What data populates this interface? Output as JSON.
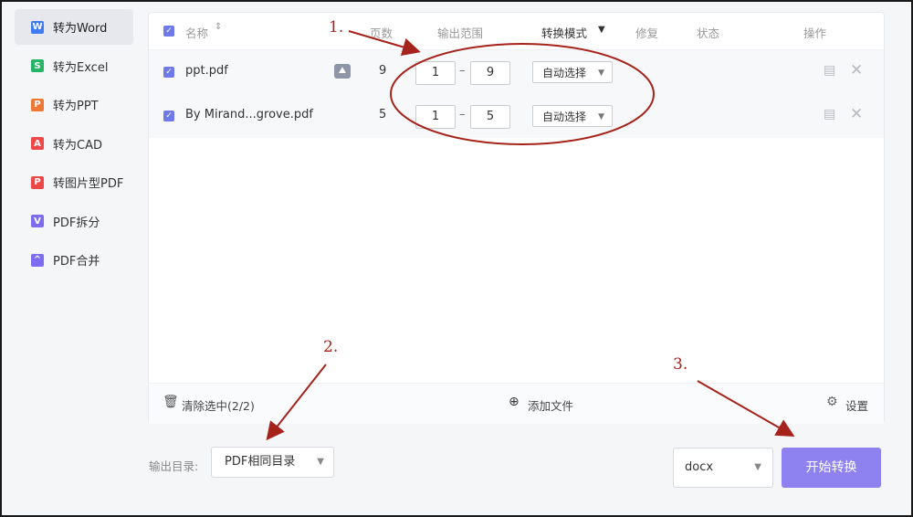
{
  "sidebar": {
    "items": [
      {
        "label": "转为Word",
        "icon": "W",
        "color": "#3f7cf2",
        "active": true
      },
      {
        "label": "转为Excel",
        "icon": "S",
        "color": "#25b565",
        "active": false
      },
      {
        "label": "转为PPT",
        "icon": "P",
        "color": "#f07836",
        "active": false
      },
      {
        "label": "转为CAD",
        "icon": "A",
        "color": "#ee4747",
        "active": false
      },
      {
        "label": "转图片型PDF",
        "icon": "P",
        "color": "#ee4747",
        "active": false
      },
      {
        "label": "PDF拆分",
        "icon": "V",
        "color": "#7c6cf0",
        "active": false
      },
      {
        "label": "PDF合并",
        "icon": "A",
        "color": "#7c6cf0",
        "active": false
      }
    ]
  },
  "table": {
    "headers": {
      "name": "名称",
      "pages": "页数",
      "range": "输出范围",
      "mode": "转换模式",
      "repair": "修复",
      "status": "状态",
      "ops": "操作"
    },
    "rows": [
      {
        "name": "ppt.pdf",
        "pages": "9",
        "from": "1",
        "to": "9",
        "mode": "自动选择",
        "has_thumb": true
      },
      {
        "name": "By Mirand...grove.pdf",
        "pages": "5",
        "from": "1",
        "to": "5",
        "mode": "自动选择",
        "has_thumb": false
      }
    ],
    "range_dash": "–"
  },
  "footer": {
    "clear": "清除选中(2/2)",
    "add": "添加文件",
    "settings": "设置"
  },
  "bottom": {
    "output_label": "输出目录:",
    "output_value": "PDF相同目录",
    "format_value": "docx",
    "start_label": "开始转换"
  },
  "annotations": {
    "a1": "1.",
    "a2": "2.",
    "a3": "3."
  },
  "colors": {
    "accent": "#6f7ae8",
    "start": "#8d82f0",
    "annotation": "#a5231b"
  }
}
